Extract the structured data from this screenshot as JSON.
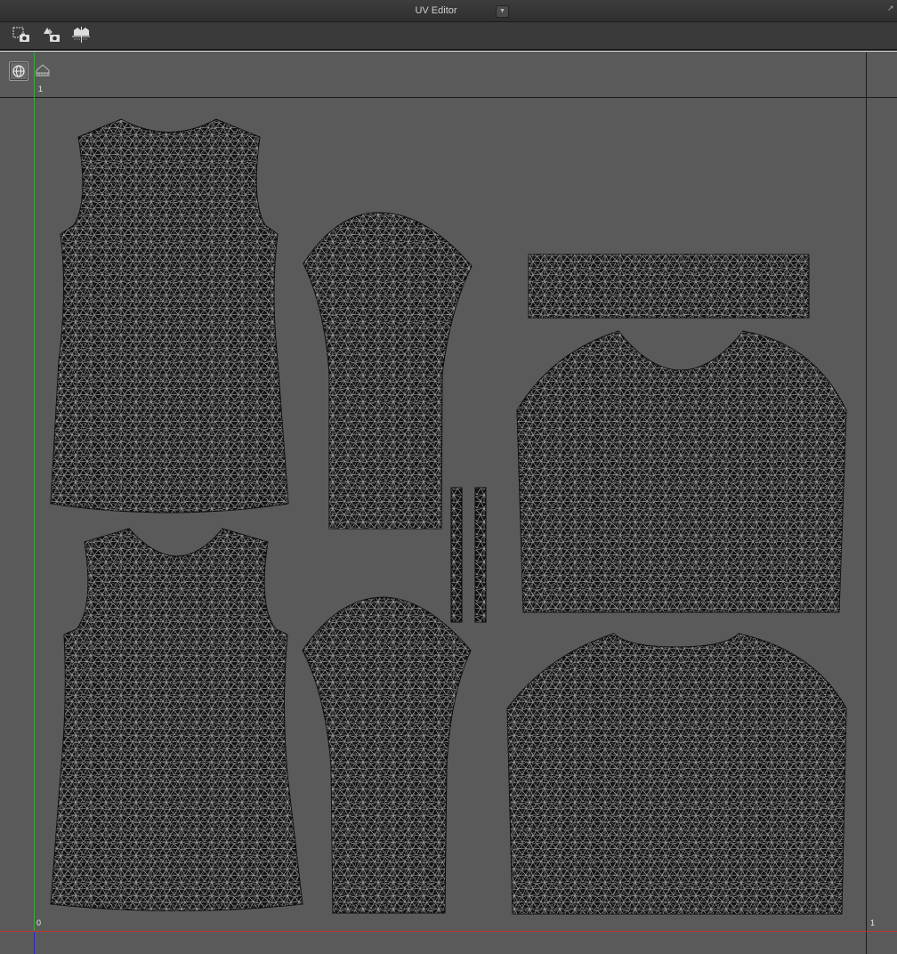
{
  "window": {
    "title": "UV Editor",
    "dropdown_glyph": "▼",
    "corner_glyph": "↗"
  },
  "toolbar": {
    "buttons": [
      {
        "name": "snapshot-uv-icon"
      },
      {
        "name": "snapshot-fill-icon"
      },
      {
        "name": "snapshot-grid-icon"
      }
    ]
  },
  "viewport": {
    "buttons": [
      {
        "name": "sphere-view-icon"
      },
      {
        "name": "ruler-icon"
      }
    ],
    "axis_labels": {
      "top_left": "1",
      "bottom_left": "0",
      "bottom_right": "1"
    }
  },
  "colors": {
    "background": "#5a5a5a",
    "pattern_fill": "#121212",
    "mesh": "#c8c8c8",
    "grid_line": "#1a1a1a",
    "v_axis": "#3aa83a",
    "u_axis": "#c83232",
    "frame": "#e0e0e0"
  },
  "uv_islands": [
    {
      "name": "uv-island-front-bodice"
    },
    {
      "name": "uv-island-sleeve-top"
    },
    {
      "name": "uv-island-waistband"
    },
    {
      "name": "uv-island-skirt-back"
    },
    {
      "name": "uv-island-strip-left"
    },
    {
      "name": "uv-island-strip-right"
    },
    {
      "name": "uv-island-back-bodice"
    },
    {
      "name": "uv-island-sleeve-bottom"
    },
    {
      "name": "uv-island-skirt-front"
    }
  ]
}
